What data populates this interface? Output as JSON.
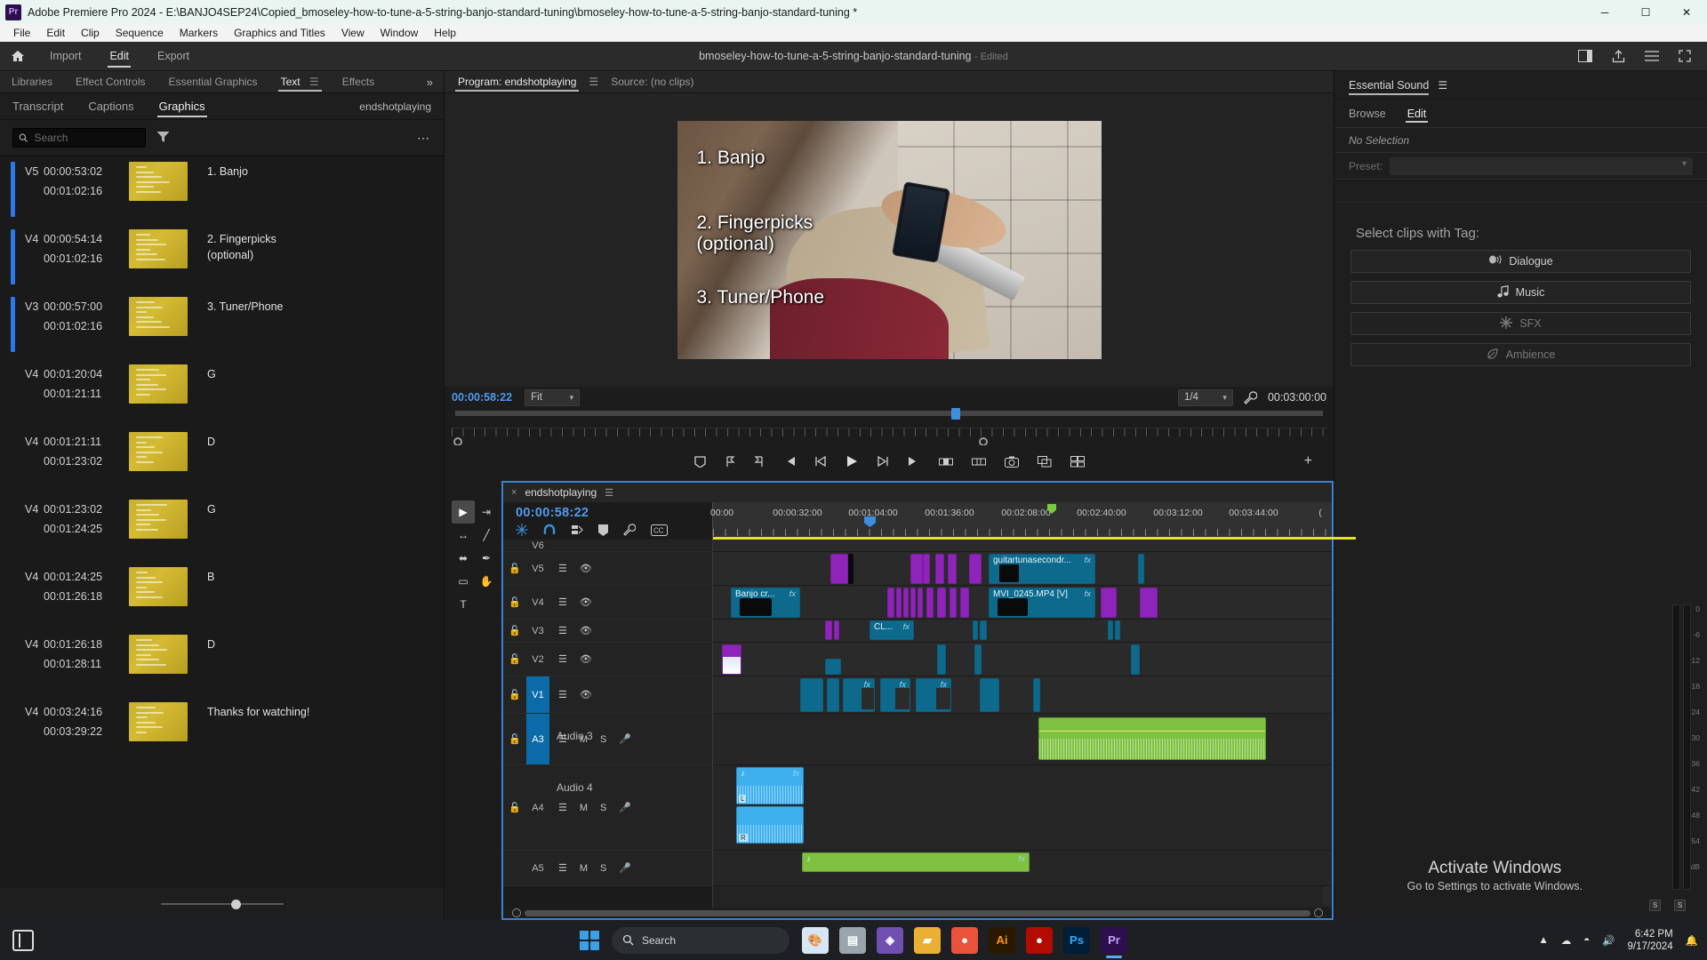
{
  "titlebar": {
    "app_badge": "Pr",
    "title": "Adobe Premiere Pro 2024 - E:\\BANJO4SEP24\\Copied_bmoseley-how-to-tune-a-5-string-banjo-standard-tuning\\bmoseley-how-to-tune-a-5-string-banjo-standard-tuning *",
    "minimize": "─",
    "maximize": "☐",
    "close": "✕"
  },
  "menubar": {
    "items": [
      "File",
      "Edit",
      "Clip",
      "Sequence",
      "Markers",
      "Graphics and Titles",
      "View",
      "Window",
      "Help"
    ]
  },
  "workspace": {
    "home_icon": "home-icon",
    "tabs": [
      {
        "label": "Import",
        "active": false
      },
      {
        "label": "Edit",
        "active": true
      },
      {
        "label": "Export",
        "active": false
      }
    ],
    "project_title": "bmoseley-how-to-tune-a-5-string-banjo-standard-tuning",
    "project_state": "- Edited",
    "right_icons": [
      "panel-layout-icon",
      "share-icon",
      "menu-icon",
      "fullscreen-icon"
    ]
  },
  "left_panel": {
    "tabs": [
      {
        "label": "Libraries",
        "active": false
      },
      {
        "label": "Effect Controls",
        "active": false
      },
      {
        "label": "Essential Graphics",
        "active": false
      },
      {
        "label": "Text",
        "active": true
      },
      {
        "label": "Effects",
        "active": false
      }
    ],
    "overflow": "»",
    "subtabs": [
      {
        "label": "Transcript",
        "active": false
      },
      {
        "label": "Captions",
        "active": false
      },
      {
        "label": "Graphics",
        "active": true
      }
    ],
    "sequence_name": "endshotplaying",
    "search": {
      "placeholder": "Search",
      "value": ""
    },
    "filter_icon": "filter-funnel-icon",
    "more_icon": "more-options-icon",
    "graphics": [
      {
        "track": "V5",
        "start": "00:00:53:02",
        "end": "00:01:02:16",
        "label": "1. Banjo",
        "selected": true
      },
      {
        "track": "V4",
        "start": "00:00:54:14",
        "end": "00:01:02:16",
        "label": "2. Fingerpicks\n(optional)",
        "selected": true
      },
      {
        "track": "V3",
        "start": "00:00:57:00",
        "end": "00:01:02:16",
        "label": "3. Tuner/Phone",
        "selected": true
      },
      {
        "track": "V4",
        "start": "00:01:20:04",
        "end": "00:01:21:11",
        "label": "G",
        "selected": false
      },
      {
        "track": "V4",
        "start": "00:01:21:11",
        "end": "00:01:23:02",
        "label": "D",
        "selected": false
      },
      {
        "track": "V4",
        "start": "00:01:23:02",
        "end": "00:01:24:25",
        "label": "G",
        "selected": false
      },
      {
        "track": "V4",
        "start": "00:01:24:25",
        "end": "00:01:26:18",
        "label": "B",
        "selected": false
      },
      {
        "track": "V4",
        "start": "00:01:26:18",
        "end": "00:01:28:11",
        "label": "D",
        "selected": false
      },
      {
        "track": "V4",
        "start": "00:03:24:16",
        "end": "00:03:29:22",
        "label": "Thanks for watching!",
        "selected": false
      }
    ]
  },
  "monitor": {
    "tabs": [
      {
        "label": "Program: endshotplaying",
        "active": true
      },
      {
        "label": "Source: (no clips)",
        "active": false
      }
    ],
    "menu_icon": "panel-menu-icon",
    "overlay_text": "1. Banjo\n\n2. Fingerpicks\n(optional)\n\n3. Tuner/Phone",
    "overlay_lines": [
      "1. Banjo",
      "2. Fingerpicks\n(optional)",
      "3. Tuner/Phone"
    ],
    "current_timecode": "00:00:58:22",
    "zoom_level": "Fit",
    "playback_resolution": "1/4",
    "settings_icon": "wrench-icon",
    "duration_timecode": "00:03:00:00",
    "transport_icons": [
      "add-marker-icon",
      "mark-in-icon",
      "mark-out-icon",
      "go-to-in-icon",
      "step-back-icon",
      "play-icon",
      "step-forward-icon",
      "go-to-out-icon",
      "lift-icon",
      "extract-icon",
      "export-frame-icon",
      "comparison-view-icon",
      "multicam-icon"
    ],
    "add_button": "+"
  },
  "toolbar": {
    "tools": [
      {
        "name": "selection-tool",
        "glyph": "▶",
        "active": true
      },
      {
        "name": "track-select-forward-tool",
        "glyph": "⇥"
      },
      {
        "name": "ripple-edit-tool",
        "glyph": "↔"
      },
      {
        "name": "rate-stretch-tool",
        "glyph": "╱"
      },
      {
        "name": "slip-tool",
        "glyph": "⬌"
      },
      {
        "name": "pen-tool",
        "glyph": "✒"
      },
      {
        "name": "rectangle-tool",
        "glyph": "▭"
      },
      {
        "name": "hand-tool",
        "glyph": "✋"
      },
      {
        "name": "type-tool",
        "glyph": "T"
      }
    ]
  },
  "timeline": {
    "tab_close": "×",
    "sequence_name": "endshotplaying",
    "menu_icon": "panel-menu-icon",
    "playhead_timecode": "00:00:58:22",
    "header_icons": [
      "snap-to-playhead-icon",
      "magnet-snap-icon",
      "linked-selection-icon",
      "add-marker-icon",
      "timeline-settings-icon",
      "captions-icon"
    ],
    "ruler_labels": [
      "00:00",
      "00:00:32:00",
      "00:01:04:00",
      "00:01:36:00",
      "00:02:08:00",
      "00:02:40:00",
      "00:03:12:00",
      "00:03:44:00",
      "("
    ],
    "video_tracks": [
      {
        "name": "V6",
        "locked": false,
        "selected": false,
        "partial": true
      },
      {
        "name": "V5",
        "locked": true,
        "selected": false
      },
      {
        "name": "V4",
        "locked": true,
        "selected": false
      },
      {
        "name": "V3",
        "locked": true,
        "selected": false
      },
      {
        "name": "V2",
        "locked": true,
        "selected": false
      },
      {
        "name": "V1",
        "locked": true,
        "selected": true
      }
    ],
    "audio_tracks": [
      {
        "name": "A3",
        "label": "Audio 3",
        "selected": true,
        "mute": "M",
        "solo": "S"
      },
      {
        "name": "A4",
        "label": "Audio 4",
        "selected": false,
        "mute": "M",
        "solo": "S"
      },
      {
        "name": "A5",
        "label": "",
        "selected": false,
        "mute": "M",
        "solo": "S"
      }
    ],
    "clip_labels": {
      "v5_clip": "guitartunasecondr...",
      "v4_clip": "MVI_0245.MP4 [V]",
      "v4_banjo": "Banjo cr...",
      "v3_clip": "CL...",
      "fx_badge": "fx"
    }
  },
  "essential_sound": {
    "panel_title": "Essential Sound",
    "menu_icon": "panel-menu-icon",
    "tabs": [
      {
        "label": "Browse",
        "active": false
      },
      {
        "label": "Edit",
        "active": true
      }
    ],
    "selection_state": "No Selection",
    "preset_label": "Preset:",
    "preset_value": "",
    "select_clips_label": "Select clips with Tag:",
    "tag_buttons": [
      {
        "label": "Dialogue",
        "icon": "dialogue-icon",
        "enabled": true
      },
      {
        "label": "Music",
        "icon": "music-note-icon",
        "enabled": true
      },
      {
        "label": "SFX",
        "icon": "sfx-burst-icon",
        "enabled": false
      },
      {
        "label": "Ambience",
        "icon": "ambience-leaf-icon",
        "enabled": false
      }
    ],
    "meter_marks": [
      "0",
      "-6",
      "-12",
      "-18",
      "-24",
      "-30",
      "-36",
      "-42",
      "-48",
      "-54",
      "dB"
    ],
    "meter_solo_buttons": [
      "S",
      "S"
    ]
  },
  "watermark": {
    "line1": "Activate Windows",
    "line2": "Go to Settings to activate Windows."
  },
  "taskbar": {
    "taskview_icon": "task-view-icon",
    "start_icon": "windows-start-icon",
    "search_placeholder": "Search",
    "search_icon": "search-icon",
    "apps": [
      {
        "name": "paint-icon",
        "glyph": "🎨",
        "color": "#d6e6f5",
        "text": ""
      },
      {
        "name": "file-explorer-icon",
        "glyph": "▤",
        "color": "#9aa4ad",
        "text": ""
      },
      {
        "name": "microsoft-store-icon",
        "glyph": "◈",
        "color": "#6f4fb0",
        "text": ""
      },
      {
        "name": "folder-icon",
        "glyph": "▰",
        "color": "#e8b135",
        "text": ""
      },
      {
        "name": "chrome-icon",
        "glyph": "●",
        "color": "#e9533b",
        "text": ""
      },
      {
        "name": "illustrator-icon",
        "glyph": "Ai",
        "color": "#2b1800",
        "text": "Ai"
      },
      {
        "name": "acrobat-icon",
        "glyph": "●",
        "color": "#b30b00",
        "text": ""
      },
      {
        "name": "photoshop-icon",
        "glyph": "Ps",
        "color": "#001e36",
        "text": "Ps"
      },
      {
        "name": "premiere-icon",
        "glyph": "Pr",
        "color": "#2d0f4e",
        "text": "Pr"
      }
    ],
    "tray_icons": [
      "chevron-up-icon",
      "onedrive-icon",
      "wifi-icon",
      "volume-icon"
    ],
    "time": "6:42 PM",
    "date": "9/17/2024",
    "notifications_icon": "notifications-icon"
  },
  "colors": {
    "accent_blue": "#4f9bf0",
    "selection_blue": "#2a79e8",
    "timeline_border": "#3d7fd0",
    "clip_video": "#0d6a8c",
    "clip_title": "#8e24b9",
    "clip_audio": "#3fb0ee",
    "clip_music": "#7fc241",
    "graphic_thumb": "#c9b02e",
    "workbar_yellow": "#e3e327"
  }
}
